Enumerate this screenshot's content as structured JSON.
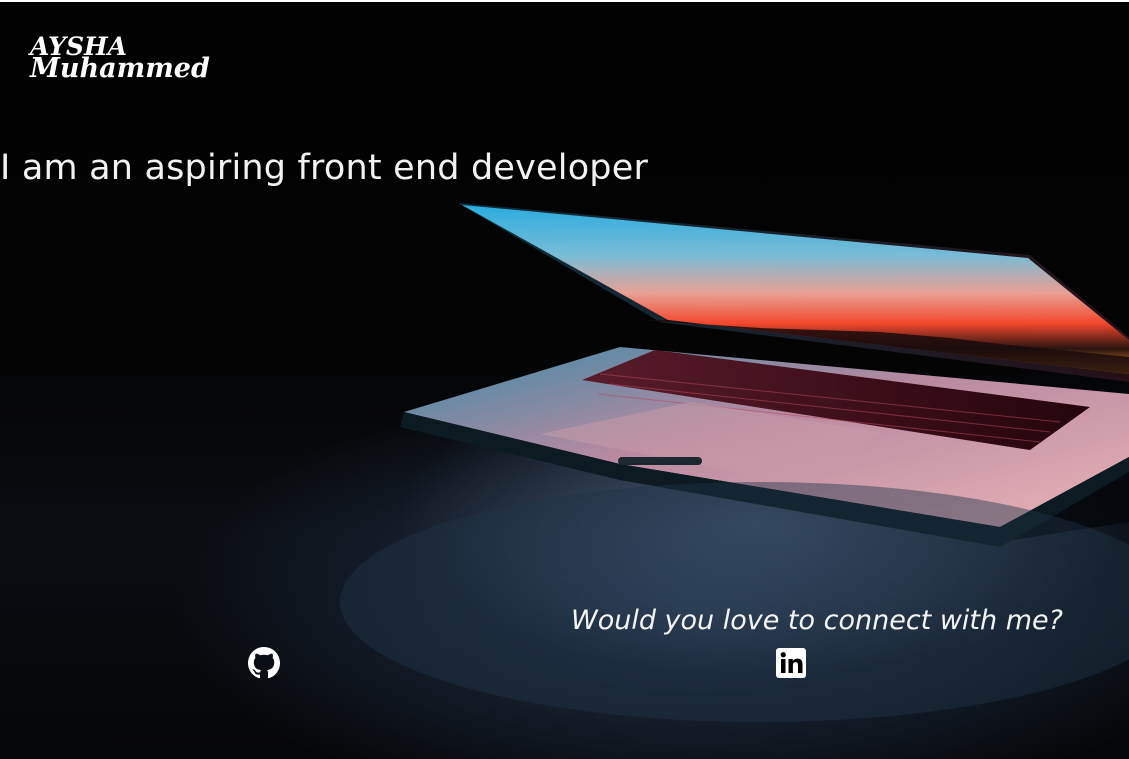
{
  "header": {
    "logo_line1": "AYSHA",
    "logo_line2": "Muhammed"
  },
  "hero": {
    "headline": "I am an aspiring front end developer",
    "background_image": "laptop-half-open-icon"
  },
  "connect": {
    "prompt": "Would you love to connect with me?",
    "links": [
      {
        "name": "github",
        "icon": "github-icon"
      },
      {
        "name": "linkedin",
        "icon": "linkedin-icon"
      }
    ]
  },
  "colors": {
    "background": "#030303",
    "text": "#ffffff",
    "screen_top": "#37b8e6",
    "screen_bottom": "#ff5a2a",
    "keyboard_glow": "#c8384a"
  }
}
